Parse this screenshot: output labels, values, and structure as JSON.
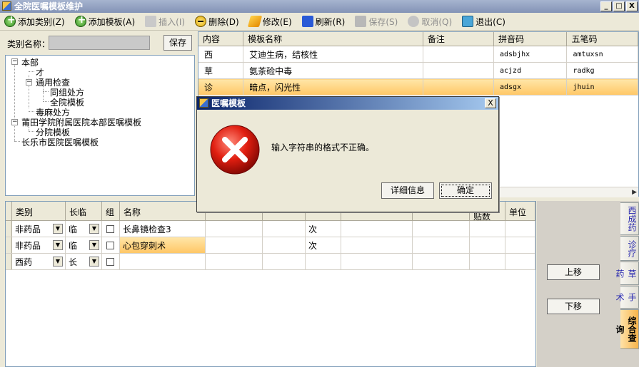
{
  "window": {
    "title": "全院医嘱模板维护",
    "btn_min": "_",
    "btn_max": "□",
    "btn_close": "X"
  },
  "toolbar": {
    "add_category": "添加类别(Z)",
    "add_template": "添加模板(A)",
    "insert": "插入(I)",
    "delete": "删除(D)",
    "modify": "修改(E)",
    "refresh": "刷新(R)",
    "save": "保存(S)",
    "cancel": "取消(Q)",
    "exit": "退出(C)"
  },
  "category": {
    "label": "类别名称：",
    "value": "",
    "save_button": "保存"
  },
  "tree": {
    "n1": "本部",
    "n2": "才",
    "n3": "通用检查",
    "n4": "同组处方",
    "n5": "全院模板",
    "n6": "毒麻处方",
    "n7": "莆田学院附属医院本部医嘱模板",
    "n8": "分院模板",
    "n9": "长乐市医院医嘱模板"
  },
  "top_grid": {
    "headers": [
      "内容",
      "模板名称",
      "备注",
      "拼音码",
      "五笔码"
    ],
    "rows": [
      [
        "西",
        "艾迪生病，结核性",
        "",
        "adsbjhx",
        "amtuxsn"
      ],
      [
        "草",
        "氨茶硷中毒",
        "",
        "acjzd",
        "radkg"
      ],
      [
        "诊",
        "暗点，闪光性",
        "",
        "adsgx",
        "jhuin"
      ]
    ]
  },
  "bottom_grid": {
    "headers": [
      "类别",
      "长临",
      "组",
      "名称",
      "",
      "",
      "",
      "",
      "",
      "贴数",
      "单位"
    ],
    "rows": [
      {
        "type": "非药品",
        "term": "临",
        "name": "长鼻镜检查3",
        "unit": "次"
      },
      {
        "type": "非药品",
        "term": "临",
        "name": "心包穿刺术",
        "unit": "次"
      },
      {
        "type": "西药",
        "term": "长",
        "name": "",
        "unit": ""
      }
    ]
  },
  "side": {
    "move_up": "上移",
    "move_down": "下移"
  },
  "tabs": [
    "西成药",
    "诊疗",
    "草药",
    "手术",
    "综合查询"
  ],
  "dialog": {
    "title": "医嘱模板",
    "message": "输入字符串的格式不正确。",
    "details_button": "详细信息",
    "ok_button": "确定",
    "close": "X"
  }
}
